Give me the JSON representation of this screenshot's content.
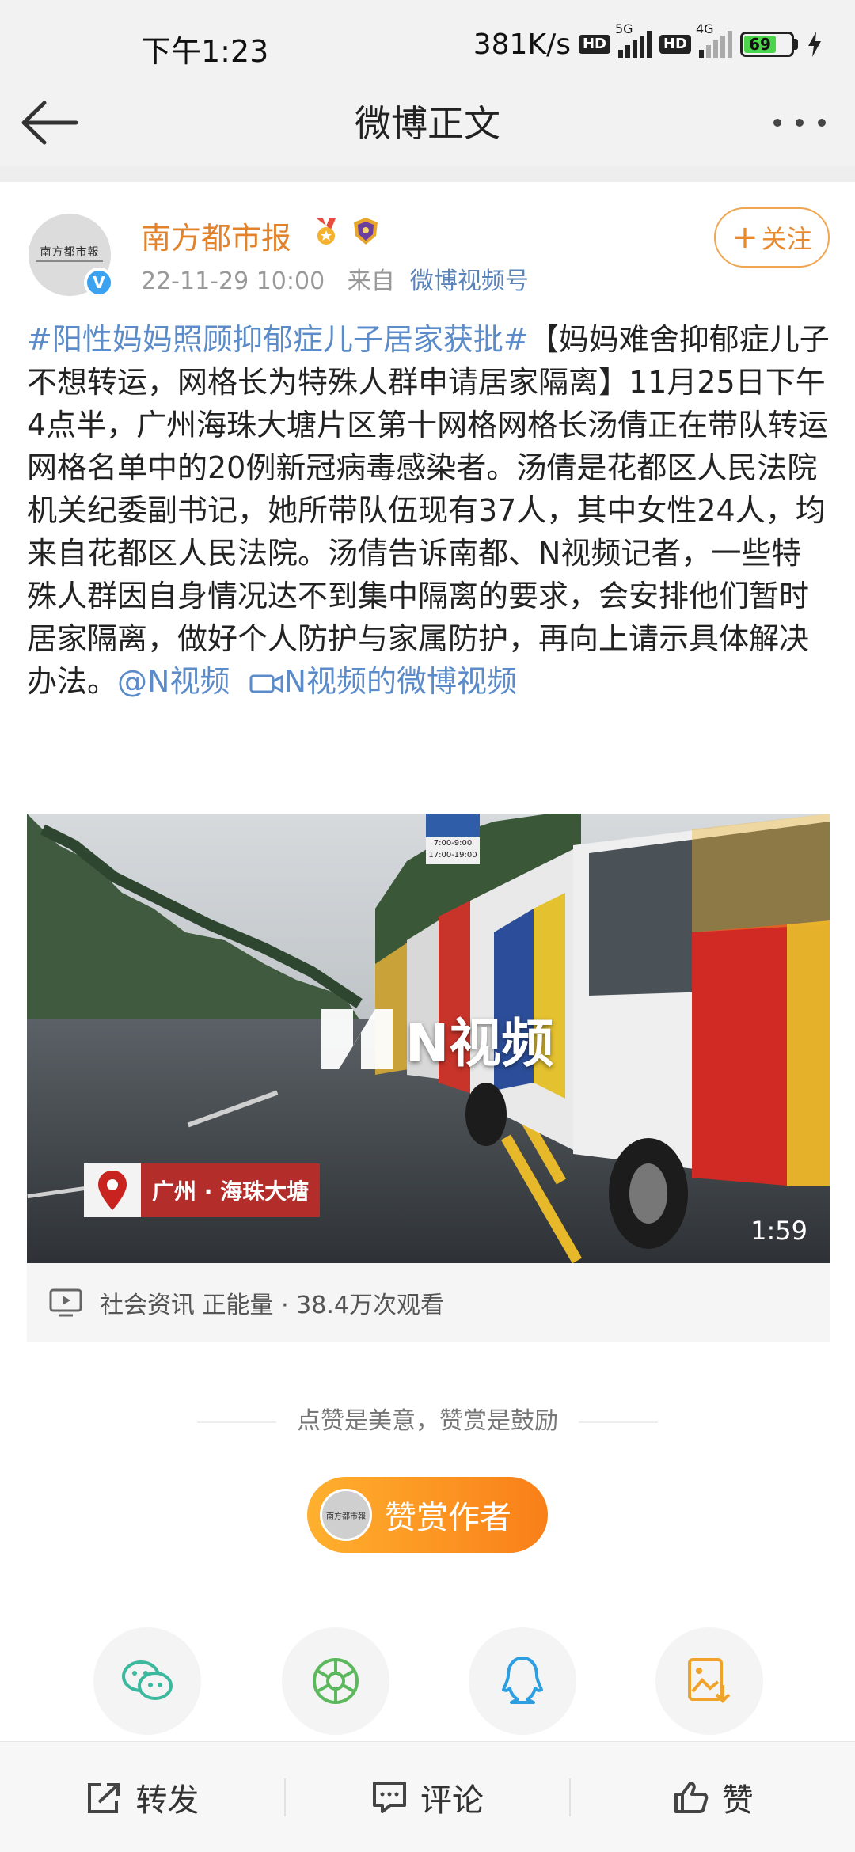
{
  "status_bar": {
    "time": "下午1:23",
    "net_speed": "381K/s",
    "hd_badge": "HD",
    "signal1": "5G",
    "signal2": "4G",
    "battery": "69",
    "battery_level": 0.69
  },
  "nav": {
    "title": "微博正文"
  },
  "post": {
    "author": "南方都市报",
    "avatar_text": "南方都市報",
    "verified": "V",
    "time": "22-11-29 10:00",
    "from_label": "来自",
    "source": "微博视频号",
    "follow_label": "关注",
    "hashtag": "#阳性妈妈照顾抑郁症儿子居家获批#",
    "body": "【妈妈难舍抑郁症儿子不想转运，网格长为特殊人群申请居家隔离】11月25日下午4点半，广州海珠大塘片区第十网格网格长汤倩正在带队转运网格名单中的20例新冠病毒感染者。汤倩是花都区人民法院机关纪委副书记，她所带队伍现有37人，其中女性24人，均来自花都区人民法院。汤倩告诉南都、N视频记者，一些特殊人群因自身情况达不到集中隔离的要求，会安排他们暂时居家隔离，做好个人防护与家属防护，再向上请示具体解决办法。",
    "mention": "@N视频",
    "video_link": "N视频的微博视频"
  },
  "video": {
    "brand": "N视频",
    "location": "广州 · 海珠大塘",
    "duration": "1:59",
    "sign_text1": "7:00-9:00",
    "sign_text2": "17:00-19:00",
    "info": "社会资讯 正能量 · 38.4万次观看"
  },
  "reward": {
    "slogan": "点赞是美意，赞赏是鼓励",
    "button": "赞赏作者"
  },
  "share_targets": [
    "wechat-icon",
    "moments-icon",
    "qq-icon",
    "save-image-icon"
  ],
  "bottom_bar": {
    "repost": "转发",
    "comment": "评论",
    "like": "赞"
  },
  "colors": {
    "accent_orange": "#e8892c",
    "link_blue": "#5b8bc9",
    "reward_gradient": "#f97f19"
  }
}
